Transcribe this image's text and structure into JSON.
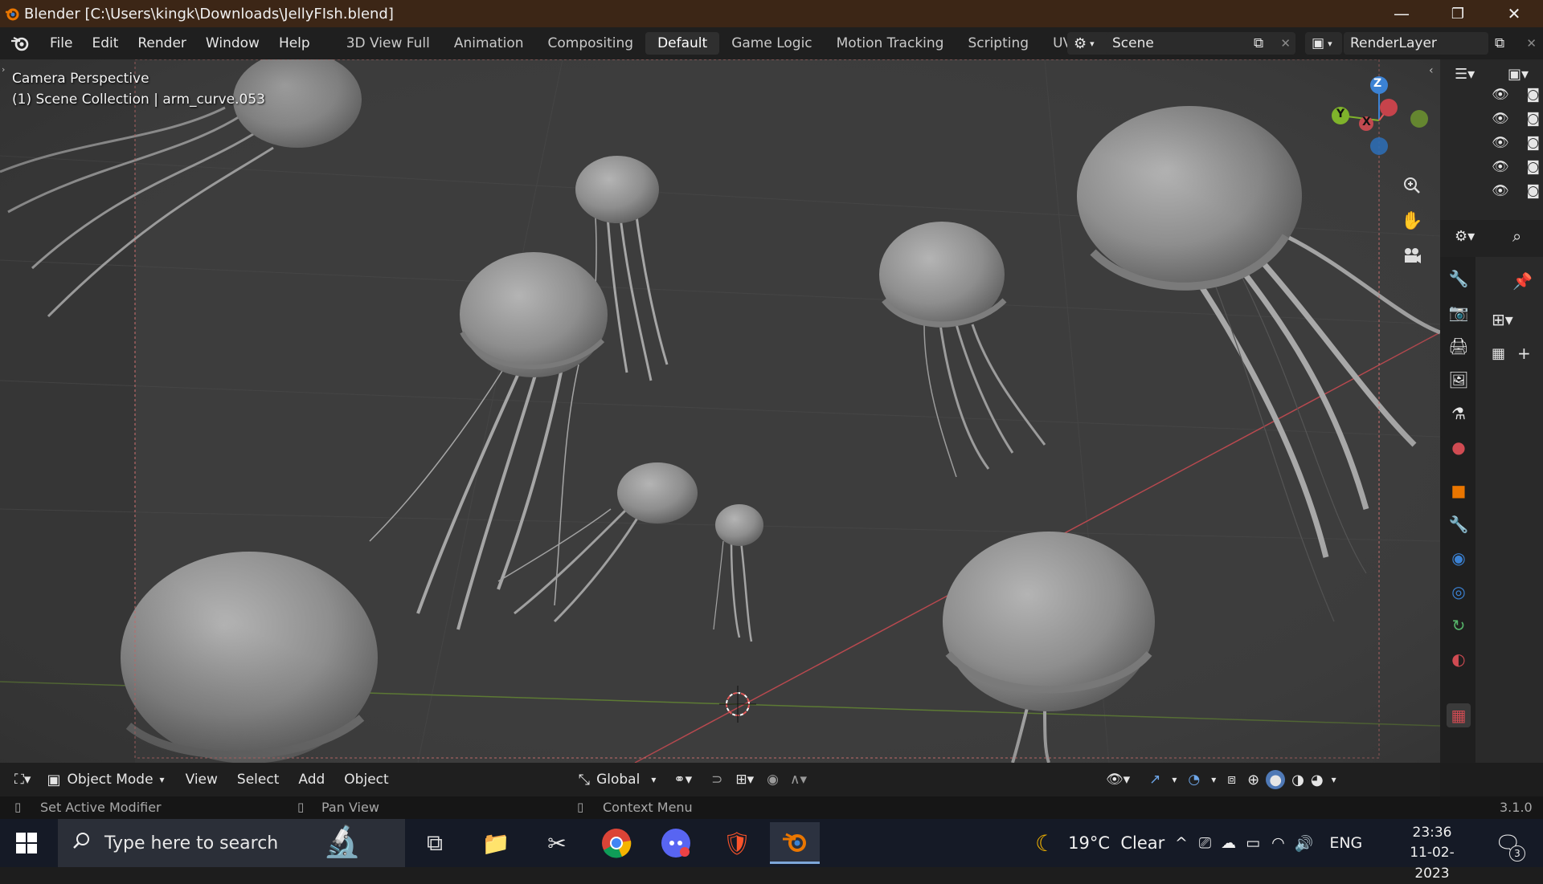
{
  "titlebar": {
    "title": "Blender [C:\\Users\\kingk\\Downloads\\JellyFIsh.blend]",
    "minimize": "—",
    "restore": "❐",
    "close": "✕"
  },
  "menu": {
    "items": [
      "File",
      "Edit",
      "Render",
      "Window",
      "Help"
    ],
    "workspaces": [
      "3D View Full",
      "Animation",
      "Compositing",
      "Default",
      "Game Logic",
      "Motion Tracking",
      "Scripting",
      "UV Editin"
    ],
    "active_workspace": "Default",
    "scene": "Scene",
    "render_layer": "RenderLayer"
  },
  "viewport": {
    "perspective": "Camera Perspective",
    "collection": "(1) Scene Collection | arm_curve.053",
    "gizmo": {
      "z": "Z",
      "y": "Y",
      "x": "X"
    }
  },
  "header": {
    "mode": "Object Mode",
    "view": "View",
    "select": "Select",
    "add": "Add",
    "object": "Object",
    "orientation": "Global"
  },
  "status": {
    "left_mouse": "Set Active Modifier",
    "middle_mouse": "Pan View",
    "right_mouse": "Context Menu",
    "version": "3.1.0"
  },
  "taskbar": {
    "search_placeholder": "Type here to search",
    "weather": "19°C  Clear",
    "language": "ENG",
    "time": "23:36",
    "date": "11-02-2023",
    "notifications": "3"
  },
  "colors": {
    "titlebar": "#3c2616",
    "viewport": "#3d3d3d",
    "axis_x": "#e05a5a",
    "axis_y": "#7fb32b",
    "axis_z": "#3b82d4",
    "blender_orange": "#ea7600"
  }
}
